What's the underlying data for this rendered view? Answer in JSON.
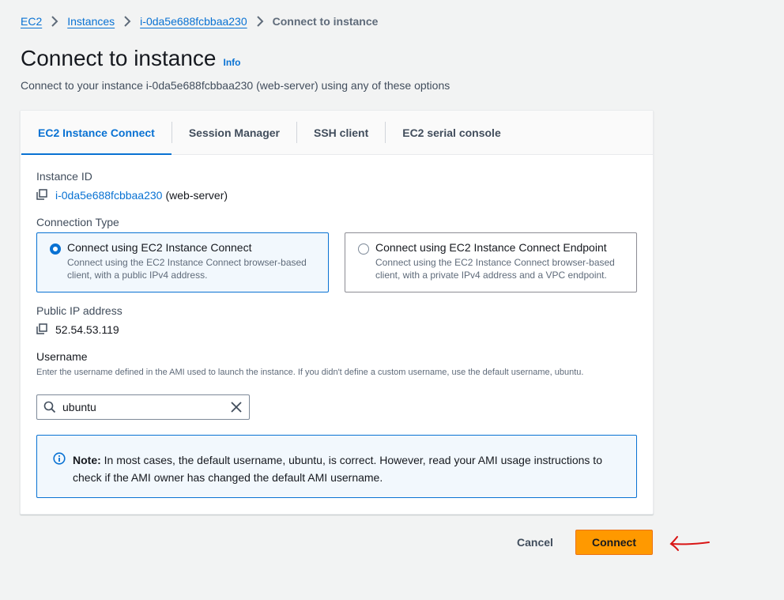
{
  "breadcrumb": {
    "items": [
      "EC2",
      "Instances",
      "i-0da5e688fcbbaa230"
    ],
    "current": "Connect to instance"
  },
  "page": {
    "title": "Connect to instance",
    "info_label": "Info",
    "description": "Connect to your instance i-0da5e688fcbbaa230 (web-server) using any of these options"
  },
  "tabs": [
    {
      "label": "EC2 Instance Connect",
      "active": true
    },
    {
      "label": "Session Manager",
      "active": false
    },
    {
      "label": "SSH client",
      "active": false
    },
    {
      "label": "EC2 serial console",
      "active": false
    }
  ],
  "instance": {
    "label": "Instance ID",
    "id": "i-0da5e688fcbbaa230",
    "name_suffix": "(web-server)"
  },
  "connection_type": {
    "label": "Connection Type",
    "options": [
      {
        "title": "Connect using EC2 Instance Connect",
        "desc": "Connect using the EC2 Instance Connect browser-based client, with a public IPv4 address.",
        "selected": true
      },
      {
        "title": "Connect using EC2 Instance Connect Endpoint",
        "desc": "Connect using the EC2 Instance Connect browser-based client, with a private IPv4 address and a VPC endpoint.",
        "selected": false
      }
    ]
  },
  "public_ip": {
    "label": "Public IP address",
    "value": "52.54.53.119"
  },
  "username": {
    "label": "Username",
    "help": "Enter the username defined in the AMI used to launch the instance. If you didn't define a custom username, use the default username, ubuntu.",
    "value": "ubuntu"
  },
  "alert": {
    "prefix": "Note:",
    "text": " In most cases, the default username, ubuntu, is correct. However, read your AMI usage instructions to check if the AMI owner has changed the default AMI username."
  },
  "actions": {
    "cancel_label": "Cancel",
    "connect_label": "Connect"
  },
  "colors": {
    "accent": "#0972d3",
    "primary_button": "#ff9900",
    "annotation_arrow": "#d91515"
  }
}
